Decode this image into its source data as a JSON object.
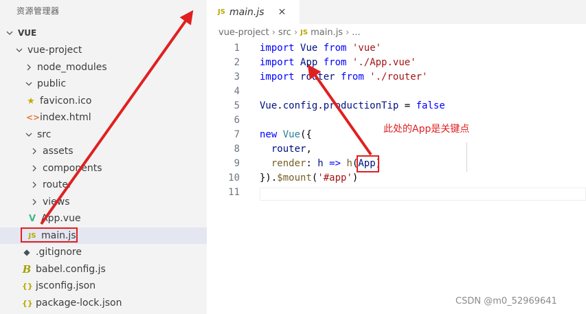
{
  "sidebar": {
    "title": "资源管理器",
    "tree": [
      {
        "label": "VUE",
        "type": "root"
      },
      {
        "label": "vue-project",
        "type": "folder-open"
      },
      {
        "label": "node_modules",
        "type": "folder-closed"
      },
      {
        "label": "public",
        "type": "folder-open"
      },
      {
        "label": "favicon.ico",
        "type": "file",
        "icon": "star-icon"
      },
      {
        "label": "index.html",
        "type": "file",
        "icon": "html-icon"
      },
      {
        "label": "src",
        "type": "folder-open"
      },
      {
        "label": "assets",
        "type": "folder-closed"
      },
      {
        "label": "components",
        "type": "folder-closed"
      },
      {
        "label": "router",
        "type": "folder-closed"
      },
      {
        "label": "views",
        "type": "folder-closed"
      },
      {
        "label": "App.vue",
        "type": "file",
        "icon": "vue-icon"
      },
      {
        "label": "main.js",
        "type": "file",
        "icon": "js-icon",
        "selected": true
      },
      {
        "label": ".gitignore",
        "type": "file",
        "icon": "git-icon"
      },
      {
        "label": "babel.config.js",
        "type": "file",
        "icon": "babel-icon"
      },
      {
        "label": "jsconfig.json",
        "type": "file",
        "icon": "json-icon"
      },
      {
        "label": "package-lock.json",
        "type": "file",
        "icon": "json-icon"
      }
    ]
  },
  "icons": {
    "js": "JS",
    "html": "<>",
    "json": "{}",
    "star": "★",
    "vue": "V",
    "git": "◆",
    "babel": "B"
  },
  "editor": {
    "tab": {
      "icon": "JS",
      "label": "main.js",
      "close": "✕"
    },
    "breadcrumb": {
      "parts": [
        "vue-project",
        "src"
      ],
      "file_icon": "JS",
      "file": "main.js",
      "more": "..."
    },
    "lines": [
      {
        "n": "1",
        "tokens": [
          [
            "kw",
            "import"
          ],
          [
            "pl",
            " "
          ],
          [
            "id",
            "Vue"
          ],
          [
            "pl",
            " "
          ],
          [
            "kw",
            "from"
          ],
          [
            "pl",
            " "
          ],
          [
            "str",
            "'vue'"
          ]
        ]
      },
      {
        "n": "2",
        "tokens": [
          [
            "kw",
            "import"
          ],
          [
            "pl",
            " "
          ],
          [
            "id",
            "App"
          ],
          [
            "pl",
            " "
          ],
          [
            "kw",
            "from"
          ],
          [
            "pl",
            " "
          ],
          [
            "str",
            "'./App.vue'"
          ]
        ]
      },
      {
        "n": "3",
        "tokens": [
          [
            "kw",
            "import"
          ],
          [
            "pl",
            " "
          ],
          [
            "id",
            "router"
          ],
          [
            "pl",
            " "
          ],
          [
            "kw",
            "from"
          ],
          [
            "pl",
            " "
          ],
          [
            "str",
            "'./router'"
          ]
        ]
      },
      {
        "n": "4",
        "tokens": []
      },
      {
        "n": "5",
        "tokens": [
          [
            "id",
            "Vue"
          ],
          [
            "pl",
            "."
          ],
          [
            "id",
            "config"
          ],
          [
            "pl",
            "."
          ],
          [
            "id",
            "productionTip"
          ],
          [
            "pl",
            " = "
          ],
          [
            "kw",
            "false"
          ]
        ]
      },
      {
        "n": "6",
        "tokens": []
      },
      {
        "n": "7",
        "tokens": [
          [
            "kw",
            "new"
          ],
          [
            "pl",
            " "
          ],
          [
            "cls",
            "Vue"
          ],
          [
            "pl",
            "({"
          ]
        ]
      },
      {
        "n": "8",
        "tokens": [
          [
            "pl",
            "  "
          ],
          [
            "id",
            "router"
          ],
          [
            "pl",
            ","
          ]
        ]
      },
      {
        "n": "9",
        "tokens": [
          [
            "pl",
            "  "
          ],
          [
            "fn",
            "render"
          ],
          [
            "pl",
            ": "
          ],
          [
            "id",
            "h"
          ],
          [
            "pl",
            " "
          ],
          [
            "kw",
            "=>"
          ],
          [
            "pl",
            " "
          ],
          [
            "fn",
            "h"
          ],
          [
            "pl",
            "("
          ],
          [
            "id",
            "App"
          ],
          [
            "pl",
            ")"
          ]
        ]
      },
      {
        "n": "10",
        "tokens": [
          [
            "pl",
            "})."
          ],
          [
            "fn",
            "$mount"
          ],
          [
            "pl",
            "("
          ],
          [
            "str",
            "'#app'"
          ],
          [
            "pl",
            ")"
          ]
        ]
      },
      {
        "n": "11",
        "tokens": []
      }
    ]
  },
  "annotation": "此处的App是关键点",
  "watermark": "CSDN @m0_52969641",
  "colors": {
    "annotation_red": "#e02020",
    "keyword_blue": "#0000ff",
    "string_red": "#a31515"
  }
}
